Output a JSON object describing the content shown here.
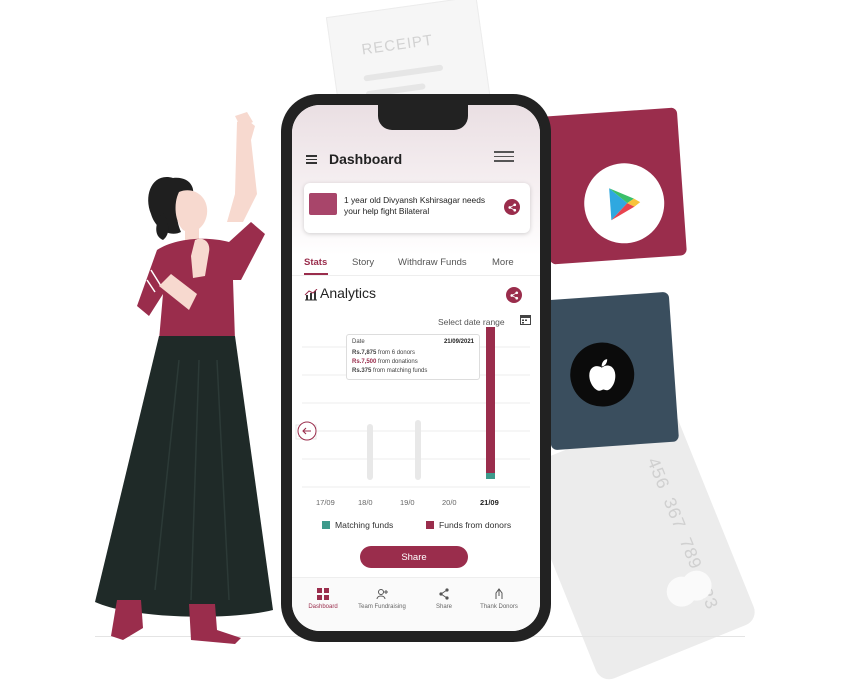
{
  "background": {
    "receipt_label": "RECEIPT",
    "card_number": "456 367 789 123"
  },
  "store_badges": [
    {
      "name": "google-play",
      "color": "#9a2d4c"
    },
    {
      "name": "apple",
      "color": "#3a4e5e"
    }
  ],
  "app": {
    "title": "Dashboard",
    "accent": "#9a2d4c",
    "campaign": {
      "text": "1 year old Divyansh Kshirsagar needs your help fight Bilateral"
    },
    "tabs": [
      {
        "label": "Stats",
        "active": true
      },
      {
        "label": "Story",
        "active": false
      },
      {
        "label": "Withdraw Funds",
        "active": false
      },
      {
        "label": "More",
        "active": false
      }
    ],
    "analytics": {
      "title": "Analytics",
      "date_range_label": "Select date range"
    },
    "tooltip": {
      "date_label": "Date",
      "date_value": "21/09/2021",
      "rows": [
        {
          "amount": "Rs.7,875",
          "text": "from 6 donors"
        },
        {
          "amount": "Rs.7,500",
          "text": "from donations"
        },
        {
          "amount": "Rs.375",
          "text": "from matching funds"
        }
      ]
    },
    "chart": {
      "x_labels": [
        "17/09",
        "18/0",
        "19/0",
        "20/0",
        "21/09"
      ],
      "active_index": 4,
      "legend": [
        {
          "label": "Matching funds",
          "color": "#3d9a8b"
        },
        {
          "label": "Funds from donors",
          "color": "#9a2d4c"
        }
      ]
    },
    "share_label": "Share",
    "bottom_nav": [
      {
        "label": "Dashboard",
        "icon": "dashboard-icon",
        "active": true
      },
      {
        "label": "Team Fundraising",
        "icon": "team-add-icon",
        "active": false
      },
      {
        "label": "Share",
        "icon": "share-icon",
        "active": false
      },
      {
        "label": "Thank Donors",
        "icon": "thank-donors-icon",
        "active": false
      }
    ]
  }
}
